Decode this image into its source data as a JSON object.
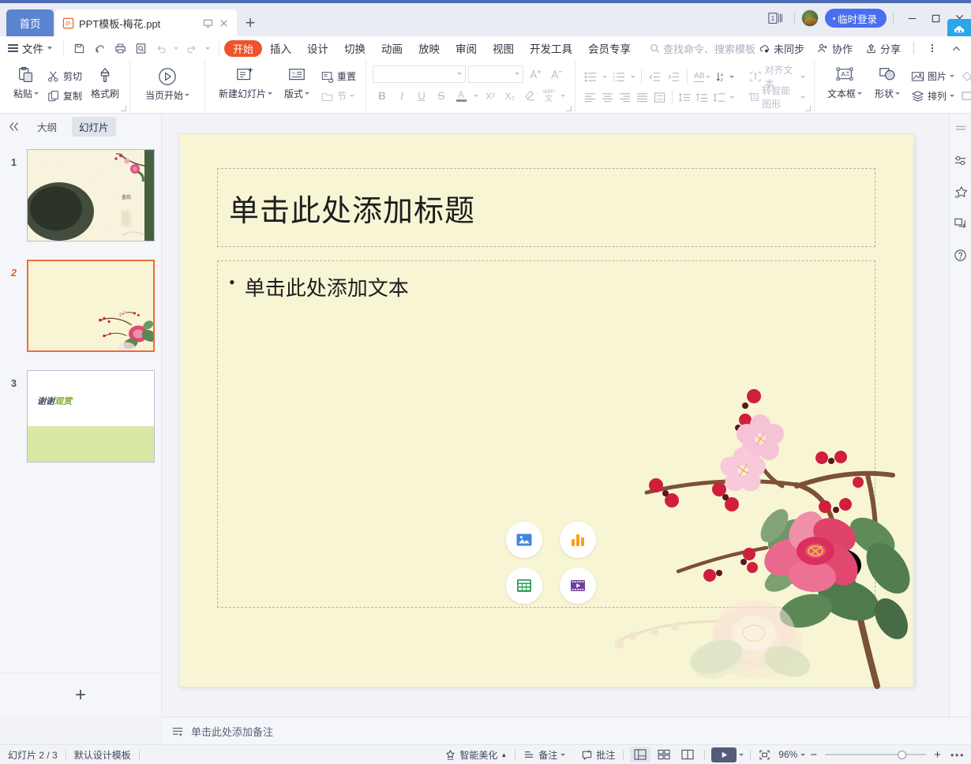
{
  "titlebar": {
    "home_tab": "首页",
    "doc_tab": "PPT模板-梅花.ppt",
    "doc_icon": "ppt-file-icon",
    "restore_icon": "restore-tab-icon",
    "close_tab_icon": "close-tab-icon",
    "new_tab_icon": "new-tab-icon",
    "page_count_badge": "1",
    "avatar_name": "user-avatar",
    "login_label": "临时登录",
    "minimize_icon": "minimize-icon",
    "maximize_icon": "maximize-icon",
    "close_icon": "close-icon",
    "cloud_icon": "wps-cloud-icon",
    "accent_blue": "#5b84d0",
    "login_blue": "#4a6ef0",
    "cloud_blue": "#2aa7ea"
  },
  "menubar": {
    "file_label": "文件",
    "quick_icons": [
      "save-icon",
      "cloud-save-icon",
      "print-icon",
      "print-preview-icon",
      "undo-icon",
      "redo-icon",
      "customize-qat-icon"
    ],
    "tabs": [
      {
        "label": "开始",
        "active": true
      },
      {
        "label": "插入",
        "active": false
      },
      {
        "label": "设计",
        "active": false
      },
      {
        "label": "切换",
        "active": false
      },
      {
        "label": "动画",
        "active": false
      },
      {
        "label": "放映",
        "active": false
      },
      {
        "label": "审阅",
        "active": false
      },
      {
        "label": "视图",
        "active": false
      },
      {
        "label": "开发工具",
        "active": false
      },
      {
        "label": "会员专享",
        "active": false
      }
    ],
    "search_placeholder": "查找命令、搜索模板",
    "right_items": [
      {
        "label": "未同步",
        "icon": "cloud-sync-icon"
      },
      {
        "label": "协作",
        "icon": "collaborate-icon"
      },
      {
        "label": "分享",
        "icon": "share-icon"
      }
    ],
    "more_icon": "more-vertical-icon",
    "collapse_ribbon_icon": "chevron-up-icon",
    "active_tab_color": "#f0522a"
  },
  "ribbon": {
    "clipboard": {
      "paste": "粘贴",
      "cut": "剪切",
      "copy": "复制",
      "format_painter": "格式刷"
    },
    "present": {
      "from_current": "当页开始"
    },
    "slides": {
      "new_slide": "新建幻灯片",
      "layout": "版式",
      "reset": "重置",
      "section": "节"
    },
    "font": {
      "font_name": "",
      "font_size": "",
      "grow_font": "A+",
      "shrink_font": "A-",
      "bold": "B",
      "italic": "I",
      "underline": "U",
      "strikethrough": "S",
      "text_color": "A",
      "superscript": "X²",
      "subscript": "X₂",
      "clear_format": "clear-format-icon",
      "pinyin": "wén"
    },
    "paragraph": {
      "bullets": "bullet-list-icon",
      "numbering": "numbered-list-icon",
      "decrease_indent": "decrease-indent-icon",
      "increase_indent": "increase-indent-icon",
      "text_direction": "AB",
      "sort": "sort-icon",
      "align_text": "对齐文本",
      "align_left": "align-left-icon",
      "align_center": "align-center-icon",
      "align_right": "align-right-icon",
      "justify": "justify-icon",
      "distribute": "distribute-icon",
      "line_spacing": "line-spacing-icon",
      "para_spacing": "para-spacing-icon",
      "row_spacing": "row-spacing-icon",
      "to_smartart": "转智能图形"
    },
    "drawing": {
      "text_box": "文本框",
      "shapes": "形状",
      "picture": "图片",
      "arrange": "排列",
      "fill": "填充",
      "outline": "轮廓"
    }
  },
  "left_panel": {
    "collapse_icon": "collapse-panel-icon",
    "tab_outline": "大纲",
    "tab_slides": "幻灯片",
    "active_tab": "幻灯片",
    "slides": [
      {
        "number": "1",
        "selected": false,
        "kind": "ink-plum-cover"
      },
      {
        "number": "2",
        "selected": true,
        "kind": "blank-plum-corner"
      },
      {
        "number": "3",
        "selected": false,
        "kind": "thanks-slide",
        "text": "谢谢观赏"
      }
    ],
    "add_slide_icon": "add-slide-icon"
  },
  "slide": {
    "background_color": "#f7f5d4",
    "title_placeholder": "单击此处添加标题",
    "body_bullet": "单击此处添加文本",
    "bullet_char": "•",
    "content_icons": [
      {
        "name": "insert-picture-icon",
        "color": "#4286e0"
      },
      {
        "name": "insert-chart-icon",
        "color": "#f9a01b"
      },
      {
        "name": "insert-table-icon",
        "color": "#33a05a"
      },
      {
        "name": "insert-media-icon",
        "color": "#6d4199"
      }
    ],
    "artwork": "plum-blossom-camellia-painting"
  },
  "notes": {
    "icon": "notes-icon",
    "placeholder": "单击此处添加备注"
  },
  "statusbar": {
    "slide_counter": "幻灯片 2 / 3",
    "design_template": "默认设计模板",
    "smart_beautify": "智能美化",
    "notes_btn": "备注",
    "comment_btn": "批注",
    "view_normal_icon": "normal-view-icon",
    "view_sorter_icon": "slide-sorter-icon",
    "view_reading_icon": "reading-view-icon",
    "play_icon": "play-icon",
    "fit_icon": "fit-to-window-icon",
    "zoom_level": "96%",
    "zoom_out": "−",
    "zoom_in": "+",
    "more_icon": "more-options-icon"
  },
  "right_rail": {
    "icons": [
      "panel-lines-icon",
      "settings-sliders-icon",
      "magic-star-icon",
      "screenshot-icon",
      "help-icon"
    ]
  }
}
